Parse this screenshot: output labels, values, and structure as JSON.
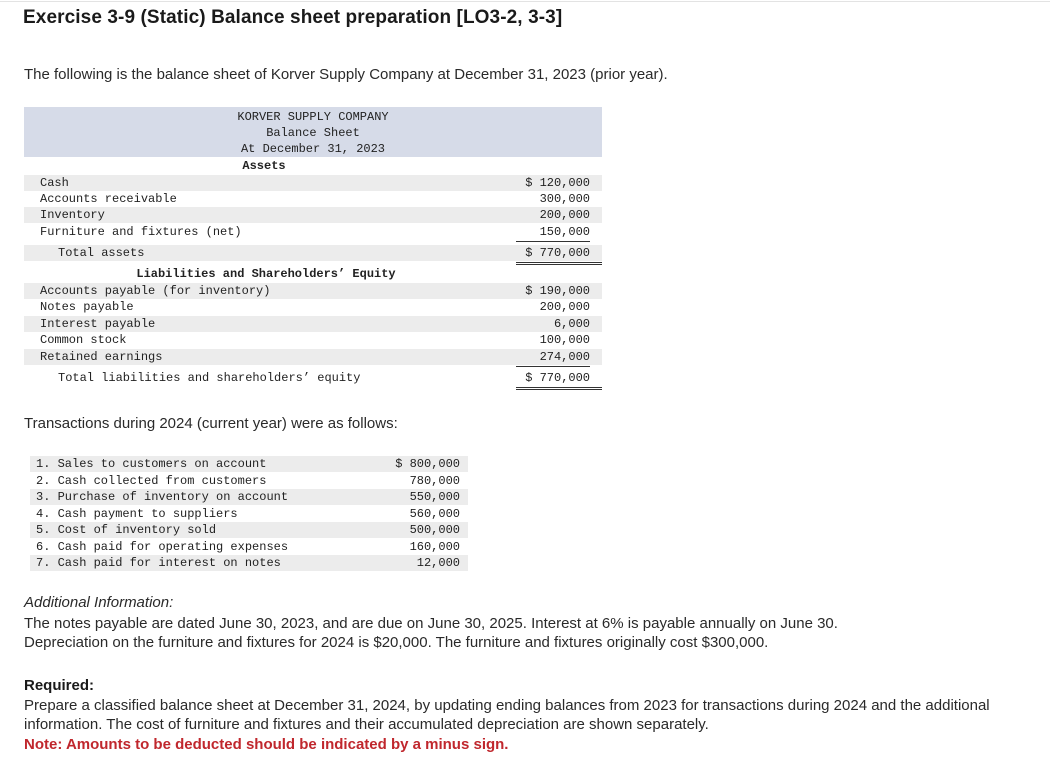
{
  "exercise": {
    "title": "Exercise 3-9 (Static) Balance sheet preparation [LO3-2, 3-3]",
    "intro": "The following is the balance sheet of Korver Supply Company at December 31, 2023 (prior year)."
  },
  "balance_sheet": {
    "company": "KORVER SUPPLY COMPANY",
    "statement": "Balance Sheet",
    "date": "At December 31, 2023",
    "assets_heading": "Assets",
    "assets": [
      {
        "label": "Cash",
        "amount": "$ 120,000"
      },
      {
        "label": "Accounts receivable",
        "amount": "300,000"
      },
      {
        "label": "Inventory",
        "amount": "200,000"
      },
      {
        "label": "Furniture and fixtures (net)",
        "amount": "150,000"
      }
    ],
    "total_assets": {
      "label": "Total assets",
      "amount": "$ 770,000"
    },
    "liabilities_heading": "Liabilities and Shareholders’ Equity",
    "liabilities": [
      {
        "label": "Accounts payable (for inventory)",
        "amount": "$ 190,000"
      },
      {
        "label": "Notes payable",
        "amount": "200,000"
      },
      {
        "label": "Interest payable",
        "amount": "6,000"
      },
      {
        "label": "Common stock",
        "amount": "100,000"
      },
      {
        "label": "Retained earnings",
        "amount": "274,000"
      }
    ],
    "total_liabilities": {
      "label": "Total liabilities and shareholders’ equity",
      "amount": "$ 770,000"
    }
  },
  "transactions": {
    "intro": "Transactions during 2024 (current year) were as follows:",
    "items": [
      {
        "label": "1. Sales to customers on account",
        "amount": "$ 800,000"
      },
      {
        "label": "2. Cash collected from customers",
        "amount": "780,000"
      },
      {
        "label": "3. Purchase of inventory on account",
        "amount": "550,000"
      },
      {
        "label": "4. Cash payment to suppliers",
        "amount": "560,000"
      },
      {
        "label": "5. Cost of inventory sold",
        "amount": "500,000"
      },
      {
        "label": "6. Cash paid for operating expenses",
        "amount": "160,000"
      },
      {
        "label": "7. Cash paid for interest on notes",
        "amount": "12,000"
      }
    ]
  },
  "additional": {
    "heading": "Additional Information:",
    "line1": "The notes payable are dated June 30, 2023, and are due on June 30, 2025. Interest at 6% is payable annually on June 30.",
    "line2": "Depreciation on the furniture and fixtures for 2024 is $20,000. The furniture and fixtures originally cost $300,000."
  },
  "required": {
    "heading": "Required:",
    "text": "Prepare a classified balance sheet at December 31, 2024, by updating ending balances from 2023 for transactions during 2024 and the additional information. The cost of furniture and fixtures and their accumulated depreciation are shown separately.",
    "note": "Note: Amounts to be deducted should be indicated by a minus sign."
  }
}
